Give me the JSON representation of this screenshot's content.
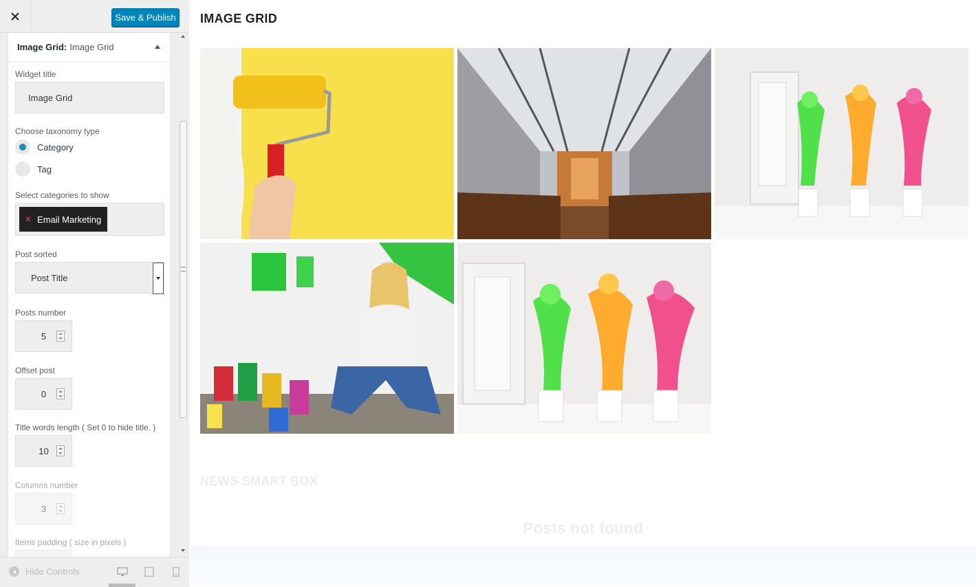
{
  "sidebar": {
    "close_label": "close",
    "save_label": "Save & Publish",
    "widget": {
      "type_label": "Image Grid:",
      "instance_label": "Image Grid"
    },
    "fields": {
      "widget_title_label": "Widget title",
      "widget_title_value": "Image Grid",
      "taxonomy_label": "Choose taxonomy type",
      "taxonomy_options": [
        "Category",
        "Tag"
      ],
      "taxonomy_selected": "Category",
      "categories_label": "Select categories to show",
      "categories_selected": [
        "Email Marketing"
      ],
      "sorted_label": "Post sorted",
      "sorted_value": "Post Title",
      "posts_number_label": "Posts number",
      "posts_number_value": "5",
      "offset_label": "Offset post",
      "offset_value": "0",
      "title_length_label": "Title words length ( Set 0 to hide title. )",
      "title_length_value": "10",
      "columns_label": "Columns number",
      "columns_value": "3",
      "padding_label": "Items padding ( size in pixels )"
    },
    "footer": {
      "hide_controls_label": "Hide Controls"
    }
  },
  "preview": {
    "section_title": "IMAGE GRID",
    "images": [
      {
        "name": "yellow-paint-roller"
      },
      {
        "name": "church-interior"
      },
      {
        "name": "paint-splash-vases"
      },
      {
        "name": "woman-with-paint-cans"
      },
      {
        "name": "paint-splash-vases-2"
      }
    ],
    "news_title": "NEWS SMART BOX",
    "not_found": "Posts not found"
  },
  "colors": {
    "primary_button": "#0085ba",
    "radio_checked": "#1e8cbe",
    "chip_bg": "#222222"
  }
}
